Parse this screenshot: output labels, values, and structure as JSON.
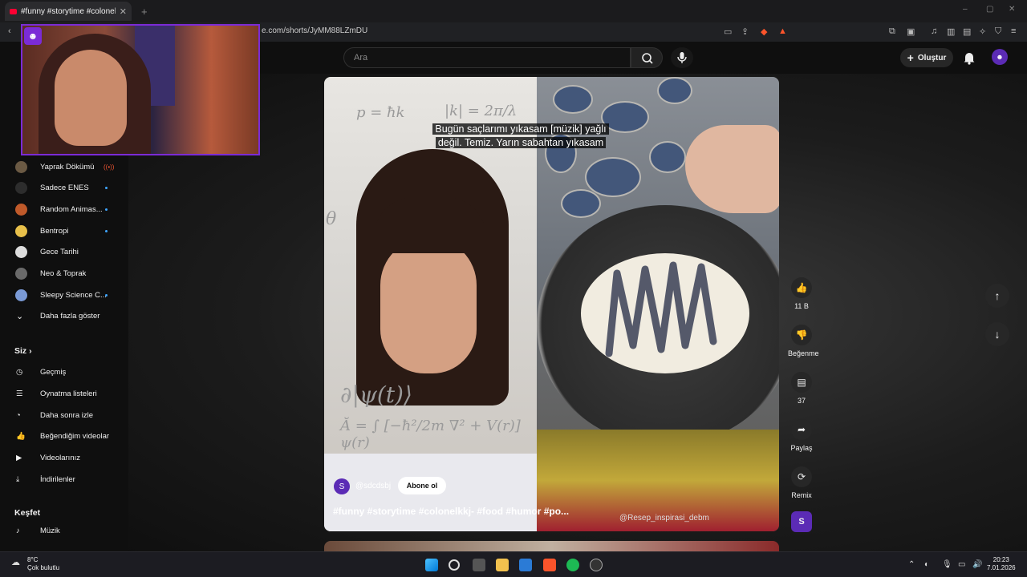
{
  "browser": {
    "tab_title": "#funny #storytime #colonelk",
    "url": "e.com/shorts/JyMM88LZmDU",
    "window_controls": [
      "–",
      "▢",
      "✕"
    ]
  },
  "header": {
    "search_placeholder": "Ara",
    "create_label": "Oluştur"
  },
  "sidebar": {
    "subscriptions": [
      {
        "label": "Yaprak Dökümü",
        "live": "((•))"
      },
      {
        "label": "Sadece ENES"
      },
      {
        "label": "Random Animas..."
      },
      {
        "label": "Bentropi"
      },
      {
        "label": "Gece Tarihi"
      },
      {
        "label": "Neo & Toprak"
      },
      {
        "label": "Sleepy Science C..."
      }
    ],
    "show_more": "Daha fazla göster",
    "you_title": "Siz",
    "you_items": [
      "Geçmiş",
      "Oynatma listeleri",
      "Daha sonra izle",
      "Beğendiğim videolar",
      "Videolarınız",
      "İndirilenler"
    ],
    "explore_title": "Keşfet",
    "explore_items": [
      "Müzik"
    ]
  },
  "short": {
    "subtitle_line1": "Bugün saçlarımı yıkasam [müzik] yağlı",
    "subtitle_line2": "değil. Temiz. Yarın sabahtan yıkasam",
    "channel_initial": "S",
    "channel_name": "@sdcdsbj",
    "subscribe_label": "Abone ol",
    "title": "#funny #storytime #colonelkkj- #food #humor #po...",
    "watermark": "@Resep_inspirasi_debm"
  },
  "actions": {
    "like_count": "11 B",
    "dislike_label": "Beğenme",
    "comment_count": "37",
    "share_label": "Paylaş",
    "remix_label": "Remix",
    "remix_initial": "S"
  },
  "taskbar": {
    "temperature": "8°C",
    "weather": "Çok bulutlu",
    "time": "20:23",
    "date": "7.01.2026"
  },
  "colors": {
    "accent": "#7b2bd6",
    "youtube_red": "#ff0033",
    "background": "#0f0f0f"
  }
}
